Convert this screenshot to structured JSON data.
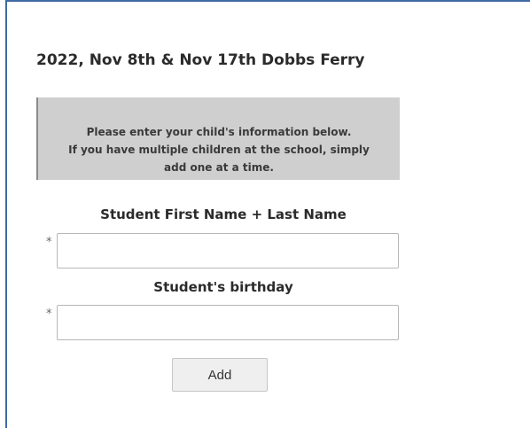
{
  "form": {
    "title": "2022, Nov 8th & Nov 17th Dobbs Ferry",
    "notice_lines": [
      "Please enter your child's information below.",
      "If you have multiple children at the school, simply",
      "add one at a time."
    ],
    "fields": [
      {
        "label": "Student First Name + Last Name",
        "required_marker": "*",
        "value": ""
      },
      {
        "label": "Student's birthday",
        "required_marker": "*",
        "value": ""
      }
    ],
    "add_button_label": "Add"
  }
}
